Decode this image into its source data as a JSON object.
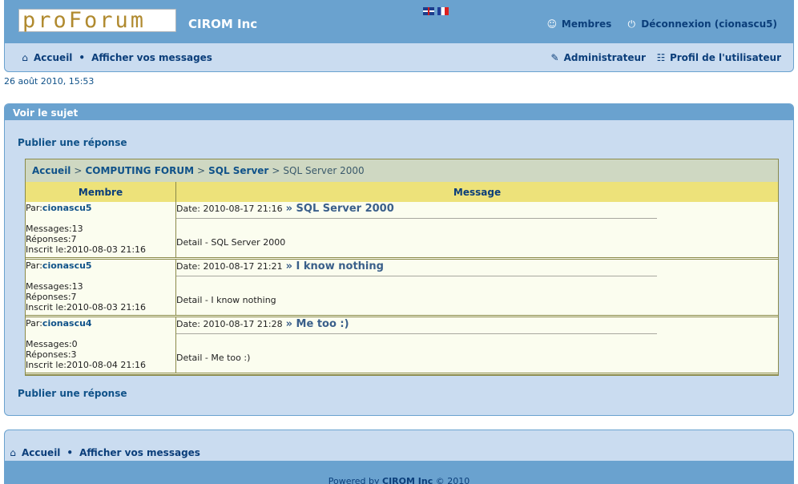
{
  "header": {
    "logo_text": "proForum",
    "site_name": "CIROM Inc",
    "members_label": "Membres",
    "logout_label": "Déconnexion (cionascu5)",
    "nav": {
      "home_label": "Accueil",
      "messages_label": "Afficher vos messages",
      "admin_label": "Administrateur",
      "profile_label": "Profil de l'utilisateur"
    }
  },
  "datetime": "26 août 2010, 15:53",
  "panel": {
    "title": "Voir le sujet",
    "reply_label": "Publier une réponse",
    "breadcrumb": {
      "home": "Accueil",
      "forum": "COMPUTING FORUM",
      "category": "SQL Server",
      "current": "SQL Server 2000",
      "sep": ">"
    },
    "columns": {
      "member": "Membre",
      "message": "Message"
    },
    "posts": [
      {
        "by_label": "Par:",
        "author": "cionascu5",
        "messages": "Messages:13",
        "replies": "Réponses:7",
        "joined": "Inscrit le:2010-08-03 21:16",
        "date": "Date: 2010-08-17 21:16",
        "title": "» SQL Server 2000",
        "body": "Detail - SQL Server 2000"
      },
      {
        "by_label": "Par:",
        "author": "cionascu5",
        "messages": "Messages:13",
        "replies": "Réponses:7",
        "joined": "Inscrit le:2010-08-03 21:16",
        "date": "Date: 2010-08-17 21:21",
        "title": "» I know nothing",
        "body": "Detail - I know nothing"
      },
      {
        "by_label": "Par:",
        "author": "cionascu4",
        "messages": "Messages:0",
        "replies": "Réponses:3",
        "joined": "Inscrit le:2010-08-04 21:16",
        "date": "Date: 2010-08-17 21:28",
        "title": "» Me too :)",
        "body": "Detail - Me too :)"
      }
    ]
  },
  "footer": {
    "home_label": "Accueil",
    "messages_label": "Afficher vos messages",
    "powered_prefix": "Powered by",
    "powered_brand": "CIROM Inc",
    "powered_suffix": "© 2010"
  },
  "colors": {
    "header_bar": "#6aa2cf",
    "panel_bg": "#cadcf0",
    "link": "#105289",
    "table_head": "#ede27a",
    "breadcrumb_bg": "#cfd8c2",
    "post_bg": "#fbfdef"
  }
}
